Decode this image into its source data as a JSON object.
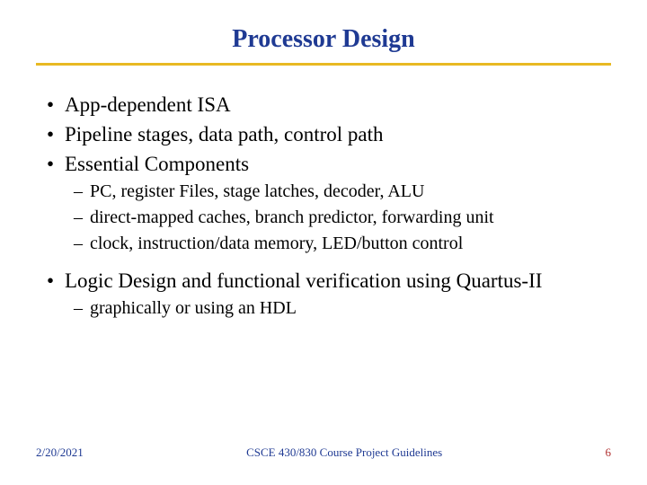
{
  "title": "Processor Design",
  "bullets": {
    "b1": "App-dependent ISA",
    "b2": "Pipeline stages, data path, control path",
    "b3": "Essential Components",
    "b3_1": "PC, register Files, stage latches, decoder, ALU",
    "b3_2": "direct-mapped caches, branch predictor, forwarding unit",
    "b3_3": "clock, instruction/data memory, LED/button control",
    "b4": "Logic Design and functional verification using Quartus-II",
    "b4_1": "graphically or using an HDL"
  },
  "footer": {
    "date": "2/20/2021",
    "center": "CSCE 430/830 Course Project Guidelines",
    "page": "6"
  },
  "colors": {
    "title": "#1f3a93",
    "rule": "#e8b923",
    "page_number": "#b03030"
  }
}
